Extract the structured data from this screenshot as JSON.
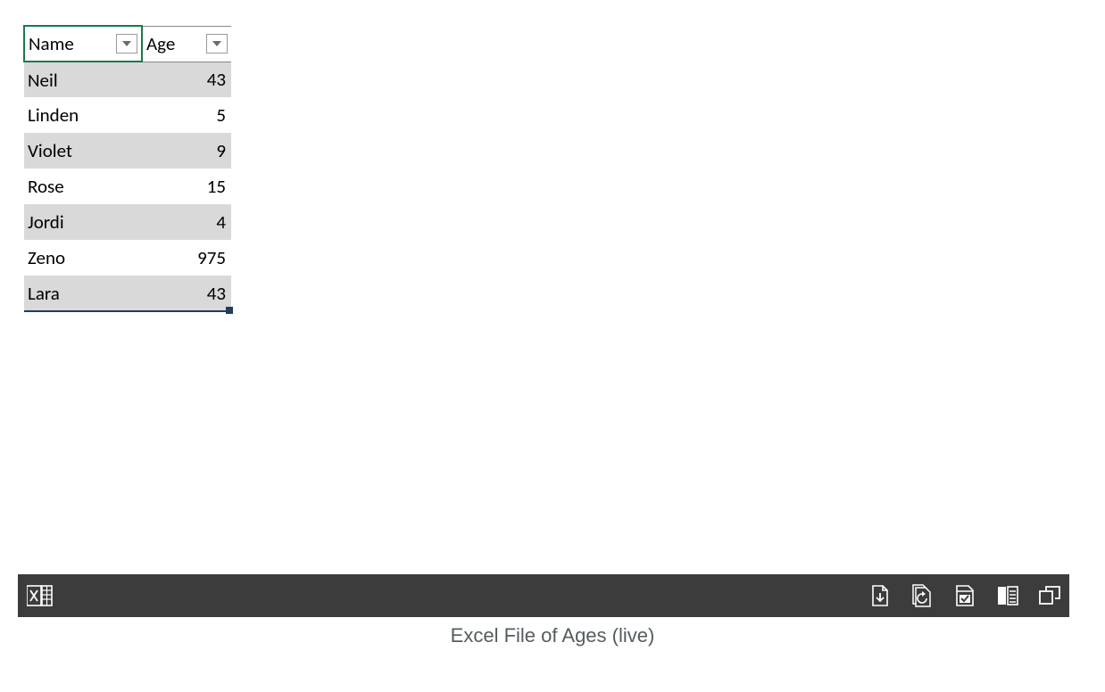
{
  "table": {
    "headers": {
      "name": "Name",
      "age": "Age"
    },
    "rows": [
      {
        "name": "Neil",
        "age": "43"
      },
      {
        "name": "Linden",
        "age": "5"
      },
      {
        "name": "Violet",
        "age": "9"
      },
      {
        "name": "Rose",
        "age": "15"
      },
      {
        "name": "Jordi",
        "age": "4"
      },
      {
        "name": "Zeno",
        "age": "975"
      },
      {
        "name": "Lara",
        "age": "43"
      }
    ]
  },
  "statusbar": {
    "app_icon": "excel-icon",
    "right_icons": [
      "download-page-icon",
      "refresh-page-icon",
      "checked-page-icon",
      "reading-view-icon",
      "popout-icon"
    ]
  },
  "caption": "Excel File of Ages (live)"
}
